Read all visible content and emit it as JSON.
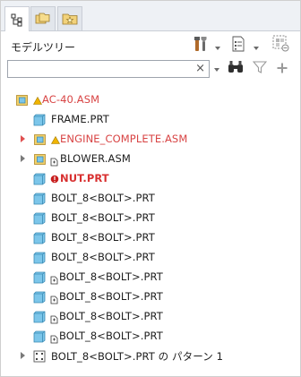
{
  "panel": {
    "title": "モデルツリー"
  },
  "search": {
    "value": "",
    "placeholder": "",
    "clear_glyph": "×"
  },
  "tree": {
    "items": [
      {
        "label": "AC-40.ASM",
        "icon": "assembly-icon",
        "status": "warning",
        "color": "#d84444"
      },
      {
        "label": "FRAME.PRT",
        "icon": "part-icon"
      },
      {
        "label": "ENGINE_COMPLETE.ASM",
        "icon": "assembly-icon",
        "status": "warning",
        "color": "#d84444",
        "expandable": true
      },
      {
        "label": "BLOWER.ASM",
        "icon": "assembly-icon",
        "status": "link",
        "expandable": true
      },
      {
        "label": "NUT.PRT",
        "icon": "part-icon",
        "status": "error",
        "color": "#d83030"
      },
      {
        "label": "BOLT_8<BOLT>.PRT",
        "icon": "part-icon"
      },
      {
        "label": "BOLT_8<BOLT>.PRT",
        "icon": "part-icon"
      },
      {
        "label": "BOLT_8<BOLT>.PRT",
        "icon": "part-icon"
      },
      {
        "label": "BOLT_8<BOLT>.PRT",
        "icon": "part-icon"
      },
      {
        "label": "BOLT_8<BOLT>.PRT",
        "icon": "part-icon",
        "status": "link"
      },
      {
        "label": "BOLT_8<BOLT>.PRT",
        "icon": "part-icon",
        "status": "link"
      },
      {
        "label": "BOLT_8<BOLT>.PRT",
        "icon": "part-icon",
        "status": "link"
      },
      {
        "label": "BOLT_8<BOLT>.PRT",
        "icon": "part-icon",
        "status": "link"
      },
      {
        "label": "BOLT_8<BOLT>.PRT の パターン 1",
        "icon": "pattern-icon",
        "expandable": true
      }
    ]
  },
  "colors": {
    "accent_red": "#d84444",
    "part_blue": "#5fb6e0",
    "assembly_yellow": "#e8c25a"
  }
}
